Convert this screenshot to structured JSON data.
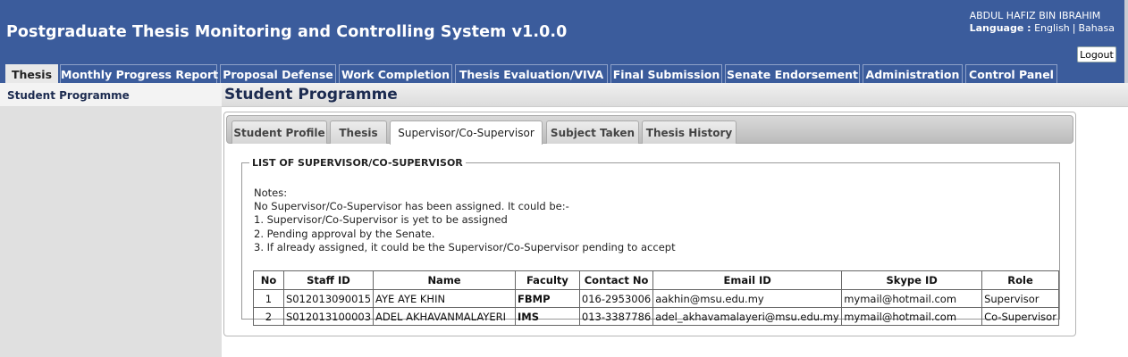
{
  "app": {
    "title": "Postgraduate Thesis Monitoring and Controlling System v1.0.0",
    "user_name": "ABDUL HAFIZ BIN IBRAHIM",
    "language_label": "Language :",
    "lang_english": "English",
    "lang_separator": "|",
    "lang_bahasa": "Bahasa",
    "logout_label": "Logout"
  },
  "nav": {
    "tabs": [
      {
        "label": "Thesis",
        "active": true
      },
      {
        "label": "Monthly Progress Report"
      },
      {
        "label": "Proposal Defense"
      },
      {
        "label": "Work Completion"
      },
      {
        "label": "Thesis Evaluation/VIVA"
      },
      {
        "label": "Final Submission"
      },
      {
        "label": "Senate Endorsement"
      },
      {
        "label": "Administration"
      },
      {
        "label": "Control Panel"
      }
    ]
  },
  "sidebar": {
    "items": [
      {
        "label": "Student Programme"
      }
    ]
  },
  "page": {
    "title": "Student Programme"
  },
  "panel": {
    "tabs": [
      {
        "label": "Student Profile"
      },
      {
        "label": "Thesis"
      },
      {
        "label": "Supervisor/Co-Supervisor",
        "active": true
      },
      {
        "label": "Subject Taken"
      },
      {
        "label": "Thesis History"
      }
    ],
    "legend": "LIST OF SUPERVISOR/CO-SUPERVISOR",
    "notes": [
      "Notes:",
      "No Supervisor/Co-Supervisor has been assigned. It could be:-",
      "1. Supervisor/Co-Supervisor is yet to be assigned",
      "2. Pending approval by the Senate.",
      "3. If already assigned, it could be the Supervisor/Co-Supervisor pending to accept"
    ],
    "table": {
      "headers": [
        "No",
        "Staff ID",
        "Name",
        "Faculty",
        "Contact No",
        "Email ID",
        "Skype ID",
        "Role"
      ],
      "rows": [
        [
          "1",
          "S012013090015",
          "AYE AYE KHIN",
          "FBMP",
          "016-2953006",
          "aakhin@msu.edu.my",
          "mymail@hotmail.com",
          "Supervisor"
        ],
        [
          "2",
          "S012013100003",
          "ADEL AKHAVANMALAYERI",
          "IMS",
          "013-3387786",
          "adel_akhavamalayeri@msu.edu.my",
          "mymail@hotmail.com",
          "Co-Supervisor"
        ]
      ]
    }
  }
}
